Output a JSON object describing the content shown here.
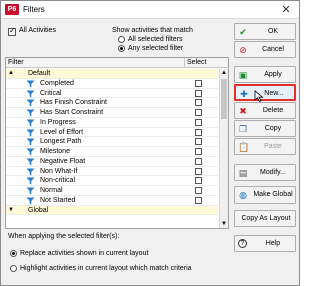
{
  "window": {
    "title": "Filters",
    "app_logo": "P6",
    "close_symbol": "✕"
  },
  "options": {
    "all_activities_label": "All Activities",
    "all_activities_checked": true,
    "show_label": "Show activities that match",
    "match_all_label": "All selected filters",
    "match_any_label": "Any selected filter",
    "match_selected": "any"
  },
  "grid": {
    "col_filter": "Filter",
    "col_select": "Select",
    "rows": [
      {
        "type": "group",
        "expander": "▲",
        "label": "Default"
      },
      {
        "type": "item",
        "label": "Completed",
        "icon": "funnel-icon"
      },
      {
        "type": "item",
        "label": "Critical",
        "icon": "funnel-icon"
      },
      {
        "type": "item",
        "label": "Has Finish Constraint",
        "icon": "funnel-icon"
      },
      {
        "type": "item",
        "label": "Has Start Constraint",
        "icon": "funnel-icon"
      },
      {
        "type": "item",
        "label": "In Progress",
        "icon": "funnel-icon"
      },
      {
        "type": "item",
        "label": "Level of Effort",
        "icon": "funnel-icon"
      },
      {
        "type": "item",
        "label": "Longest Path",
        "icon": "funnel-icon"
      },
      {
        "type": "item",
        "label": "Milestone",
        "icon": "funnel-icon"
      },
      {
        "type": "item",
        "label": "Negative Float",
        "icon": "funnel-icon"
      },
      {
        "type": "item",
        "label": "Non What-If",
        "icon": "funnel-icon"
      },
      {
        "type": "item",
        "label": "Non-critical",
        "icon": "funnel-icon"
      },
      {
        "type": "item",
        "label": "Normal",
        "icon": "funnel-icon"
      },
      {
        "type": "item",
        "label": "Not Started",
        "icon": "funnel-icon"
      },
      {
        "type": "group",
        "expander": "▼",
        "label": "Global"
      }
    ]
  },
  "bottom": {
    "applying_label": "When applying the selected filter(s):",
    "replace_label": "Replace activities shown in current layout",
    "highlight_label": "Highlight activities in current layout which match criteria",
    "selected": "replace"
  },
  "buttons": {
    "ok": "OK",
    "cancel": "Cancel",
    "apply": "Apply",
    "new": "New...",
    "delete": "Delete",
    "copy": "Copy",
    "paste": "Paste",
    "modify": "Modify...",
    "make_global": "Make Global",
    "copy_as_layout": "Copy As Layout",
    "help": "Help"
  },
  "colors": {
    "brand_red": "#c8102e",
    "highlight_border": "#e0312b",
    "group_row_bg": "#fff9d6",
    "funnel_blue": "#2a7fc9"
  }
}
